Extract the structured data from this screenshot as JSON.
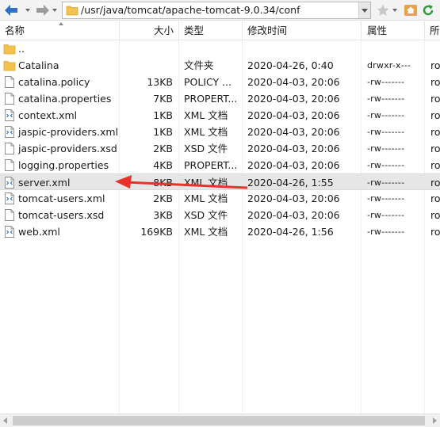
{
  "toolbar": {
    "path": "/usr/java/tomcat/apache-tomcat-9.0.34/conf",
    "icons": [
      "back-arrow-icon",
      "forward-arrow-icon",
      "folder-icon",
      "star-icon",
      "home-icon",
      "refresh-icon"
    ],
    "accent_color": "#2f6fc4"
  },
  "columns": {
    "name": "名称",
    "size": "大小",
    "type": "类型",
    "modified": "修改时间",
    "attributes": "属性",
    "owner": "所"
  },
  "files": [
    {
      "name": "..",
      "size": "",
      "type": "",
      "modified": "",
      "attributes": "",
      "owner": "",
      "icon": "folder-icon"
    },
    {
      "name": "Catalina",
      "size": "",
      "type": "文件夹",
      "modified": "2020-04-26, 0:40",
      "attributes": "drwxr-x---",
      "owner": "ro",
      "icon": "folder-icon"
    },
    {
      "name": "catalina.policy",
      "size": "13KB",
      "type": "POLICY ...",
      "modified": "2020-04-03, 20:06",
      "attributes": "-rw-------",
      "owner": "ro",
      "icon": "document-icon"
    },
    {
      "name": "catalina.properties",
      "size": "7KB",
      "type": "PROPERT...",
      "modified": "2020-04-03, 20:06",
      "attributes": "-rw-------",
      "owner": "ro",
      "icon": "document-icon"
    },
    {
      "name": "context.xml",
      "size": "1KB",
      "type": "XML 文档",
      "modified": "2020-04-03, 20:06",
      "attributes": "-rw-------",
      "owner": "ro",
      "icon": "xml-file-icon"
    },
    {
      "name": "jaspic-providers.xml",
      "size": "1KB",
      "type": "XML 文档",
      "modified": "2020-04-03, 20:06",
      "attributes": "-rw-------",
      "owner": "ro",
      "icon": "xml-file-icon"
    },
    {
      "name": "jaspic-providers.xsd",
      "size": "2KB",
      "type": "XSD 文件",
      "modified": "2020-04-03, 20:06",
      "attributes": "-rw-------",
      "owner": "ro",
      "icon": "document-icon"
    },
    {
      "name": "logging.properties",
      "size": "4KB",
      "type": "PROPERT...",
      "modified": "2020-04-03, 20:06",
      "attributes": "-rw-------",
      "owner": "ro",
      "icon": "document-icon"
    },
    {
      "name": "server.xml",
      "size": "8KB",
      "type": "XML 文档",
      "modified": "2020-04-26, 1:55",
      "attributes": "-rw-------",
      "owner": "ro",
      "icon": "xml-file-icon",
      "selected": true
    },
    {
      "name": "tomcat-users.xml",
      "size": "2KB",
      "type": "XML 文档",
      "modified": "2020-04-03, 20:06",
      "attributes": "-rw-------",
      "owner": "ro",
      "icon": "xml-file-icon"
    },
    {
      "name": "tomcat-users.xsd",
      "size": "3KB",
      "type": "XSD 文件",
      "modified": "2020-04-03, 20:06",
      "attributes": "-rw-------",
      "owner": "ro",
      "icon": "document-icon"
    },
    {
      "name": "web.xml",
      "size": "169KB",
      "type": "XML 文档",
      "modified": "2020-04-26, 1:56",
      "attributes": "-rw-------",
      "owner": "ro",
      "icon": "xml-file-icon"
    }
  ],
  "annotation": {
    "icon": "red-arrow-icon",
    "color": "#e8322b"
  },
  "colors": {
    "folder": "#f2c14e",
    "selected_row": "#e6e6e6"
  }
}
